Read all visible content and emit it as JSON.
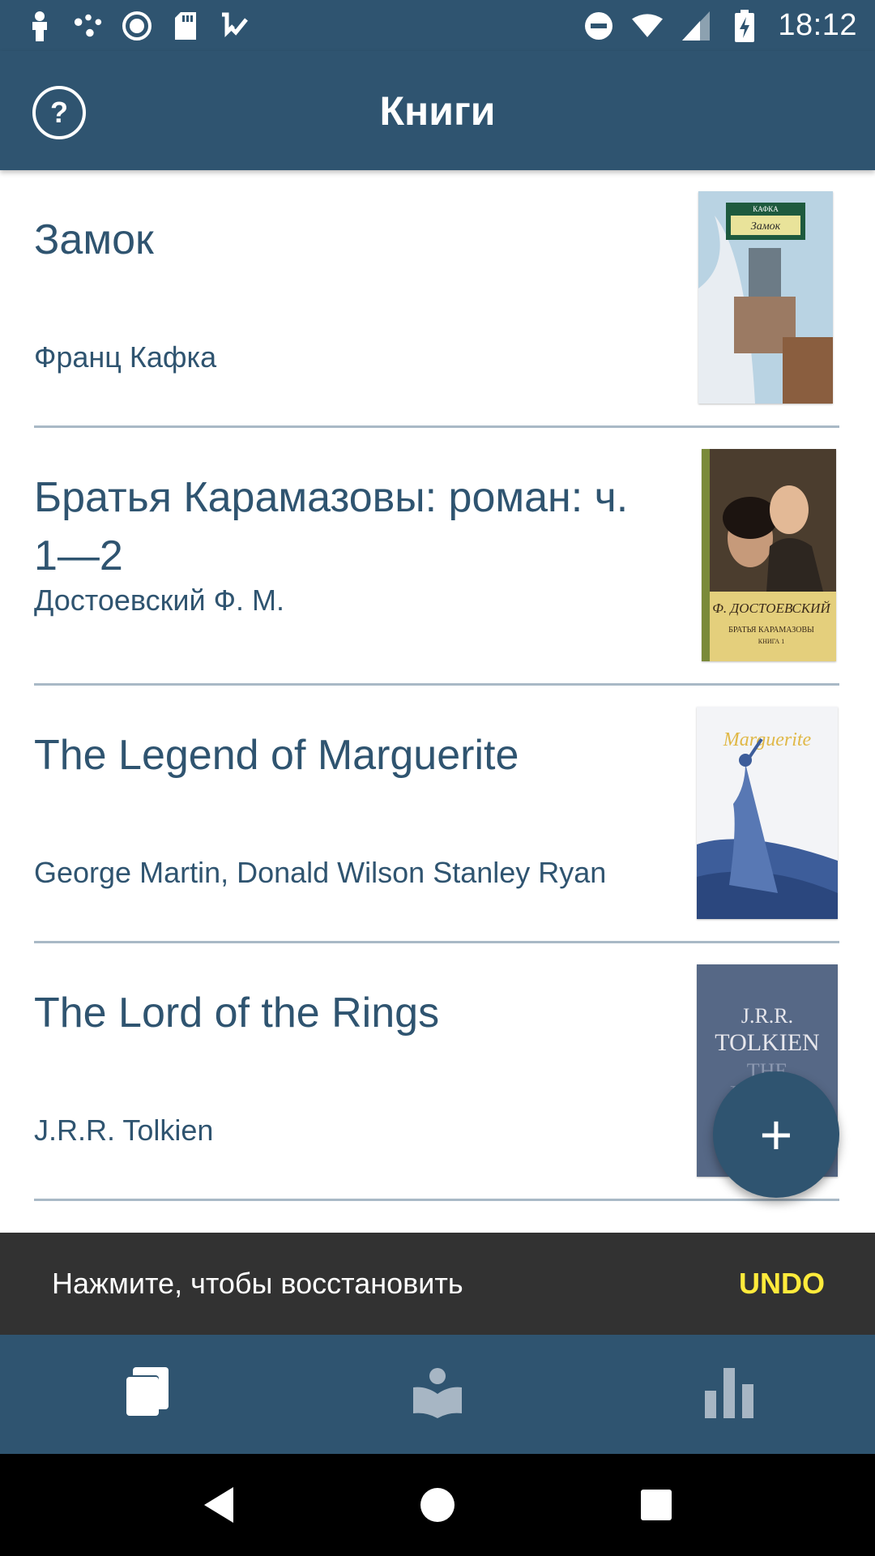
{
  "status_bar": {
    "time": "18:12",
    "icons_left": [
      "person-icon",
      "dots-icon",
      "record-icon",
      "sd-card-icon",
      "task-icon"
    ],
    "icons_right": [
      "dnd-icon",
      "wifi-icon",
      "signal-icon",
      "battery-charging-icon"
    ]
  },
  "app_bar": {
    "title": "Книги",
    "help_label": "?"
  },
  "books": [
    {
      "title": "Замок",
      "author": "Франц Кафка",
      "cover_icon": "book-cover-zamok"
    },
    {
      "title": "Братья Карамазовы: роман: ч. 1—2",
      "author": "Достоевский Ф. М.",
      "cover_icon": "book-cover-karamazovy"
    },
    {
      "title": "The Legend of Marguerite",
      "author": "George Martin, Donald Wilson Stanley Ryan",
      "cover_icon": "book-cover-marguerite"
    },
    {
      "title": "The Lord of the Rings",
      "author": "J.R.R. Tolkien",
      "cover_icon": "book-cover-lotr"
    }
  ],
  "fab": {
    "label": "+"
  },
  "snackbar": {
    "message": "Нажмите, чтобы восстановить",
    "action": "UNDO"
  },
  "bottom_nav": {
    "items": [
      "books-icon",
      "reading-icon",
      "stats-icon"
    ],
    "active_index": 0
  },
  "colors": {
    "primary": "#2f5470",
    "snackbar_bg": "#323232",
    "snackbar_action": "#ffeb3b",
    "divider": "#a9b9c6"
  }
}
